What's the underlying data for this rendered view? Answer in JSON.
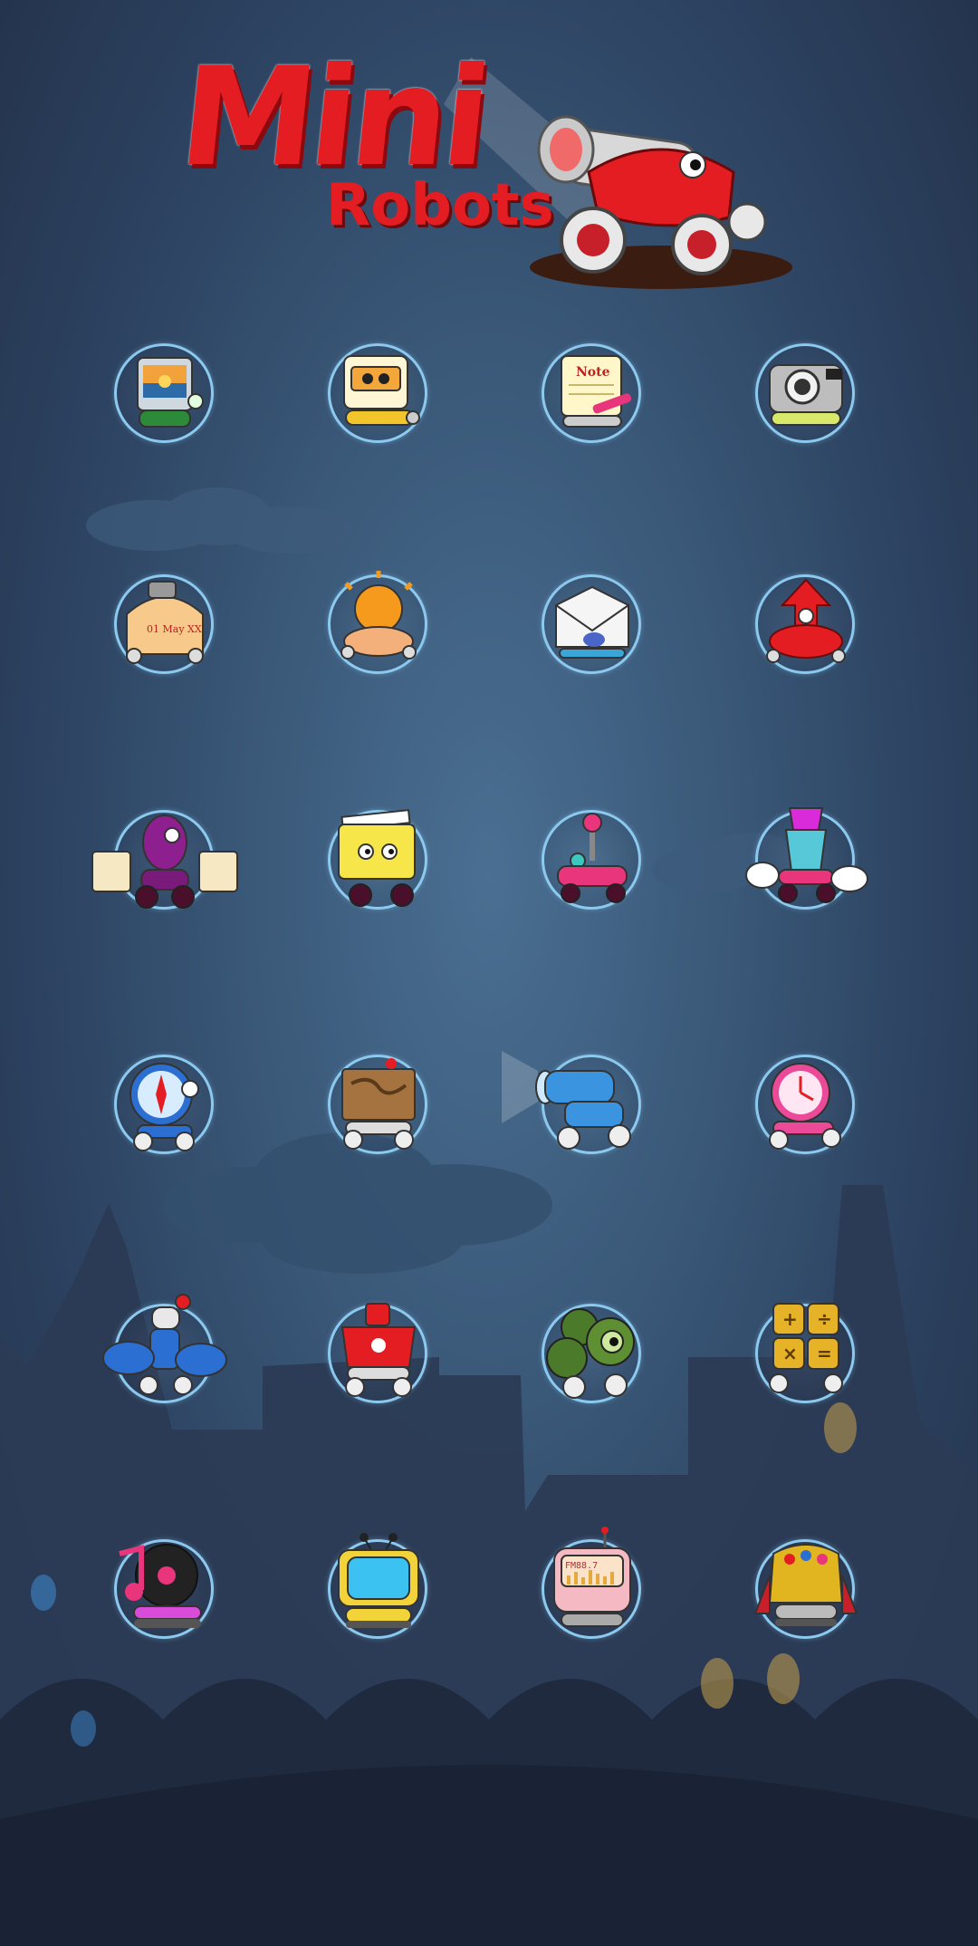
{
  "title": {
    "mini": "Mini",
    "robots": "Robots"
  },
  "colors": {
    "brand_red": "#e41d22",
    "ring": "#8cc9ef",
    "background": "#3a5878"
  },
  "apps": [
    {
      "icon": "gallery-robot-icon"
    },
    {
      "icon": "video-robot-icon"
    },
    {
      "icon": "note-robot-icon",
      "label": "Note"
    },
    {
      "icon": "camera-robot-icon"
    },
    {
      "icon": "calendar-robot-icon",
      "label": "01 May XX"
    },
    {
      "icon": "weather-robot-icon"
    },
    {
      "icon": "mail-robot-icon"
    },
    {
      "icon": "upload-robot-icon"
    },
    {
      "icon": "shopping-robot-icon"
    },
    {
      "icon": "files-robot-icon"
    },
    {
      "icon": "joystick-robot-icon"
    },
    {
      "icon": "market-robot-icon"
    },
    {
      "icon": "compass-robot-icon"
    },
    {
      "icon": "map-robot-icon"
    },
    {
      "icon": "flashlight-robot-icon"
    },
    {
      "icon": "clock-robot-icon"
    },
    {
      "icon": "location-robot-icon"
    },
    {
      "icon": "store-robot-icon"
    },
    {
      "icon": "settings-robot-icon"
    },
    {
      "icon": "calculator-robot-icon"
    },
    {
      "icon": "music-robot-icon"
    },
    {
      "icon": "tv-robot-icon"
    },
    {
      "icon": "radio-robot-icon",
      "label": "FM88.7"
    },
    {
      "icon": "toolbox-robot-icon"
    }
  ]
}
